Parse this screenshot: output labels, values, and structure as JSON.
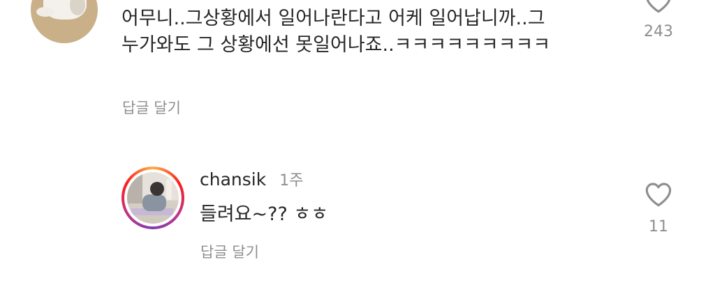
{
  "comment1": {
    "text_line1": "어무니..그상황에서 일어나란다고 어케 일어납니까..그",
    "text_line2": "누가와도 그 상황에선 못일어나죠..ㅋㅋㅋㅋㅋㅋㅋㅋㅋ",
    "reply_label": "답글 달기",
    "like_count": "243",
    "like_icon": "heart-outline"
  },
  "comment2": {
    "username": "chansik",
    "time": "1주",
    "text": "들려요~?? ㅎㅎ",
    "reply_label": "답글 달기",
    "like_count": "11",
    "like_icon": "heart-outline"
  },
  "colors": {
    "primary_text": "#262626",
    "secondary_text": "#8e8e8e",
    "story_ring": [
      "#fcb045",
      "#fd1d1d",
      "#c13584",
      "#833ab4"
    ]
  }
}
